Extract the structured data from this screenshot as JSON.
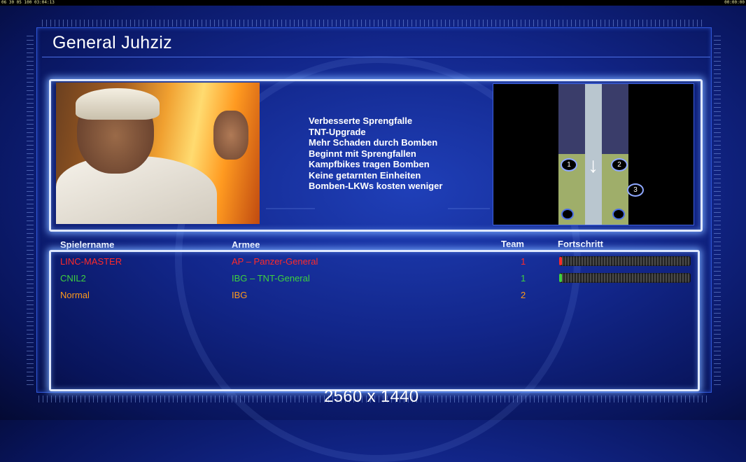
{
  "status_left": "06 30 05 100 03:04:13",
  "status_right": "00:00:00",
  "general": {
    "title": "General Juhziz",
    "traits": [
      "Verbesserte Sprengfalle",
      "TNT-Upgrade",
      "Mehr Schaden durch Bomben",
      "Beginnt mit Sprengfallen",
      "Kampfbikes tragen Bomben",
      "Keine getarnten Einheiten",
      "Bomben-LKWs kosten weniger"
    ]
  },
  "minimap": {
    "start_markers": [
      "1",
      "2",
      "3"
    ]
  },
  "players": {
    "headers": {
      "name": "Spielername",
      "army": "Armee",
      "team": "Team",
      "progress": "Fortschritt"
    },
    "rows": [
      {
        "name": "LINC-MASTER",
        "army": "AP – Panzer-General",
        "team": "1",
        "color": "#ff2a2a",
        "progress": 0.02
      },
      {
        "name": "CNIL2",
        "army": "IBG – TNT-General",
        "team": "1",
        "color": "#3ed13e",
        "progress": 0.02
      },
      {
        "name": "Normal",
        "army": "IBG",
        "team": "2",
        "color": "#ff9a1a",
        "progress": 0
      }
    ]
  },
  "resolution_label": "2560 x 1440",
  "colors": {
    "frame": "#2f56d8",
    "glow": "#dfe8ff",
    "background": "#12268a"
  }
}
